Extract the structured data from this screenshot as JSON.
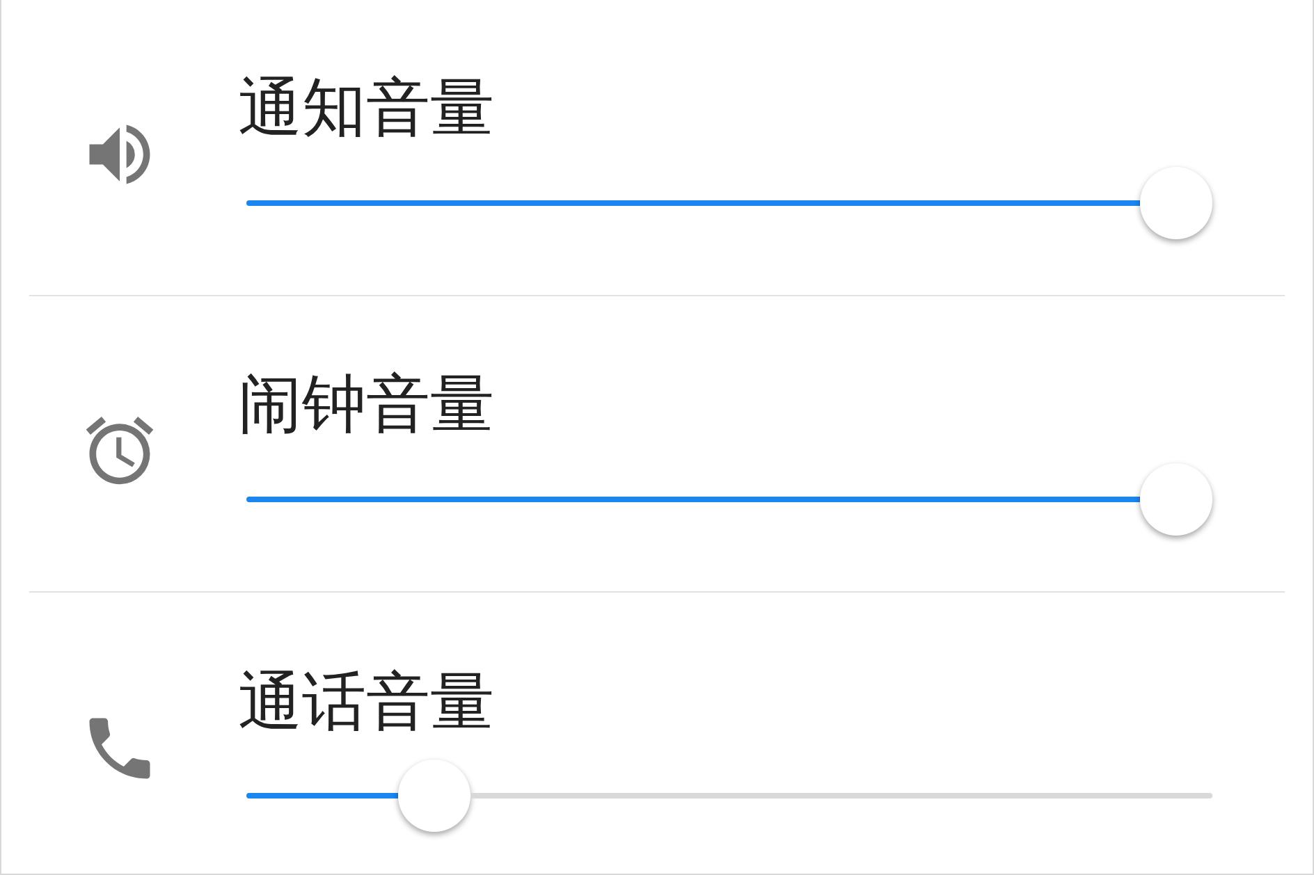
{
  "volume_settings": [
    {
      "kind": "notification",
      "title": "通知音量",
      "level": 1
    },
    {
      "kind": "alarm",
      "title": "闹钟音量",
      "level": 1
    },
    {
      "kind": "call",
      "title": "通话音量",
      "level": 0.17
    }
  ]
}
